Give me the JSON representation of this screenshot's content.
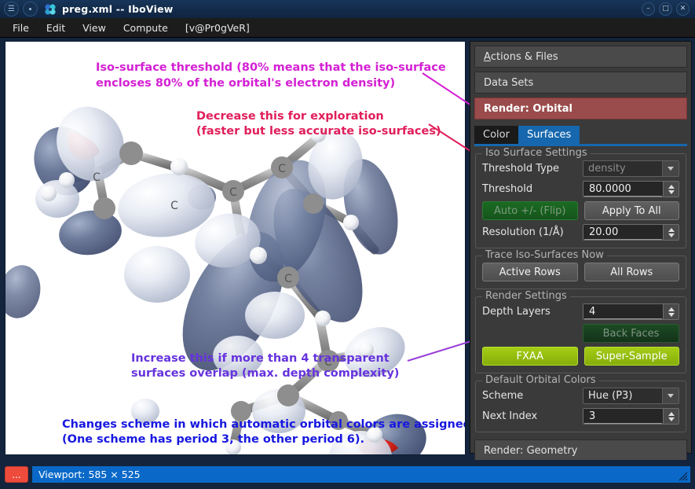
{
  "window": {
    "title": "preg.xml -- IboView",
    "menu_icon": "hamburger-icon",
    "dot_icon": "dot-icon",
    "app_logo": "iboview-logo-icon",
    "minimize_label": "–",
    "maximize_label": "□",
    "close_label": "✕"
  },
  "menubar": {
    "items": [
      {
        "label": "File"
      },
      {
        "label": "Edit"
      },
      {
        "label": "View"
      },
      {
        "label": "Compute"
      },
      {
        "label": "[v@Pr0gVeR]"
      }
    ]
  },
  "annotations": [
    {
      "id": "threshold-note",
      "color": "#d420d4",
      "line1": "Iso-surface threshold (80% means that the iso-surface",
      "line2": "encloses 80% of the orbital's electron density)"
    },
    {
      "id": "resolution-note",
      "color": "#e01e5a",
      "line1": "Decrease this for exploration",
      "line2": "(faster but less accurate iso-surfaces)"
    },
    {
      "id": "depth-layers-note",
      "color": "#6633dd",
      "line1": "Increase this if more than 4 transparent",
      "line2": "surfaces overlap (max. depth complexity)"
    },
    {
      "id": "scheme-note",
      "color": "#1717e0",
      "line1": "Changes scheme in which automatic orbital colors are assigned",
      "line2": "(One scheme has period 3, the other period 6)."
    }
  ],
  "sidepanel": {
    "sections": [
      {
        "label": "Actions & Files",
        "accel": "A",
        "active": false
      },
      {
        "label": "Data Sets",
        "accel": "",
        "active": false
      },
      {
        "label": "Render: Orbital",
        "accel": "",
        "active": true
      }
    ],
    "bottom_section": {
      "label": "Render: Geometry"
    },
    "tabs": [
      {
        "label": "Color",
        "active": false
      },
      {
        "label": "Surfaces",
        "active": true
      }
    ],
    "iso_surface_settings": {
      "legend": "Iso Surface Settings",
      "threshold_type_label": "Threshold Type",
      "threshold_type_value": "density",
      "threshold_label": "Threshold",
      "threshold_value": "80.0000",
      "auto_flip_label": "Auto +/- (Flip)",
      "apply_to_all_label": "Apply To All",
      "resolution_label": "Resolution (1/Å)",
      "resolution_value": "20.00"
    },
    "trace_iso_surfaces": {
      "legend": "Trace Iso-Surfaces Now",
      "active_rows_label": "Active Rows",
      "all_rows_label": "All Rows"
    },
    "render_settings": {
      "legend": "Render Settings",
      "depth_layers_label": "Depth Layers",
      "depth_layers_value": "4",
      "back_faces_label": "Back Faces",
      "fxaa_label": "FXAA",
      "super_sample_label": "Super-Sample"
    },
    "default_orbital_colors": {
      "legend": "Default Orbital Colors",
      "scheme_label": "Scheme",
      "scheme_value": "Hue (P3)",
      "next_index_label": "Next Index",
      "next_index_value": "3"
    }
  },
  "statusbar": {
    "menu_button_label": "...",
    "viewport_text": "Viewport: 585 × 525",
    "resize_grip_icon": "resize-grip-icon"
  },
  "colors": {
    "titlebar": "#132c4b",
    "accent_blue": "#1667ad",
    "section_active": "#9a4b4b",
    "lime": "#a4ce14",
    "status_blue": "#0a69c8",
    "panel_bg": "#3a3a3a"
  }
}
